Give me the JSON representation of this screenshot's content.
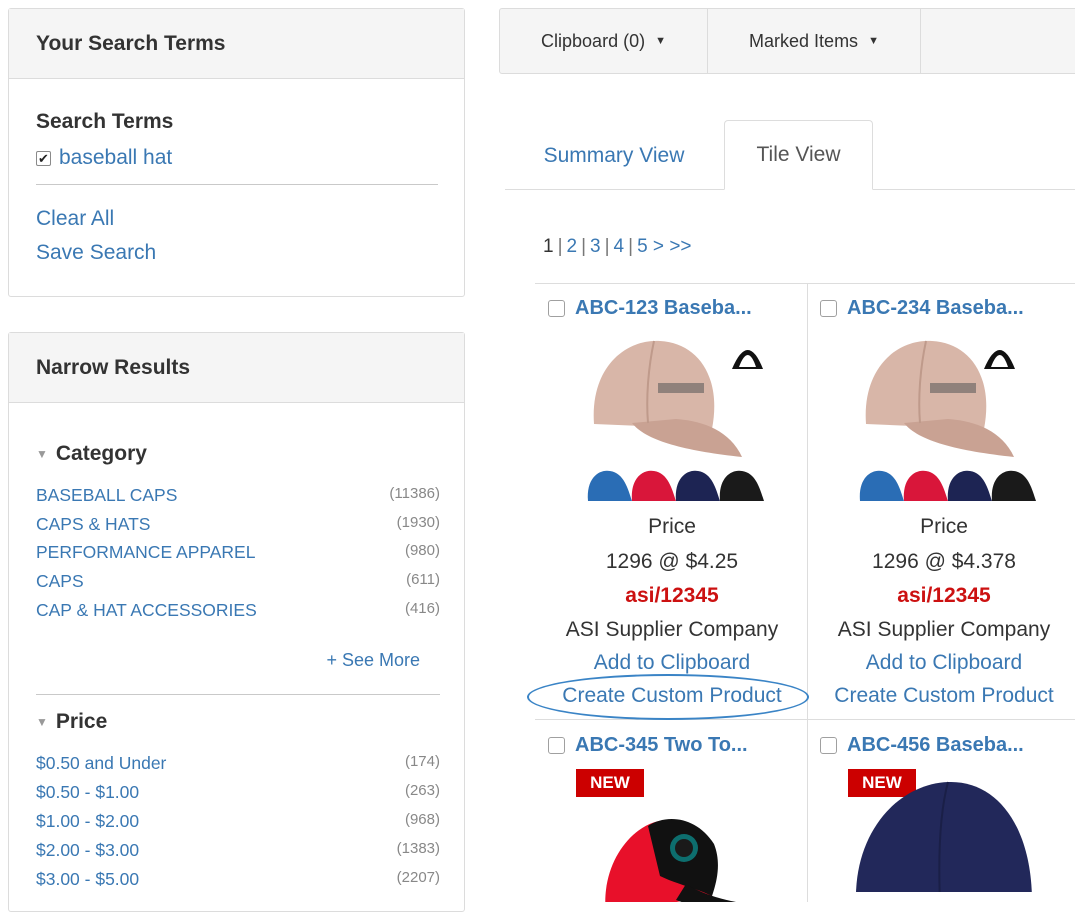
{
  "search_panel": {
    "header": "Your Search Terms",
    "section_title": "Search Terms",
    "term": "baseball hat",
    "clear_all": "Clear All",
    "save_search": "Save Search"
  },
  "narrow_panel": {
    "header": "Narrow Results",
    "category": {
      "title": "Category",
      "items": [
        {
          "label": "BASEBALL CAPS",
          "count": "(11386)"
        },
        {
          "label": "CAPS & HATS",
          "count": "(1930)"
        },
        {
          "label": "PERFORMANCE APPAREL",
          "count": "(980)"
        },
        {
          "label": "CAPS",
          "count": "(611)"
        },
        {
          "label": "CAP & HAT ACCESSORIES",
          "count": "(416)"
        }
      ],
      "see_more": "+ See More"
    },
    "price": {
      "title": "Price",
      "items": [
        {
          "label": "$0.50 and Under",
          "count": "(174)"
        },
        {
          "label": "$0.50 - $1.00",
          "count": "(263)"
        },
        {
          "label": "$1.00 - $2.00",
          "count": "(968)"
        },
        {
          "label": "$2.00 - $3.00",
          "count": "(1383)"
        },
        {
          "label": "$3.00 - $5.00",
          "count": "(2207)"
        }
      ]
    }
  },
  "toolbar": {
    "clipboard": "Clipboard (0)",
    "marked_items": "Marked Items"
  },
  "tabs": {
    "summary": "Summary View",
    "tile": "Tile View"
  },
  "pager": {
    "current": "1",
    "pages": [
      "2",
      "3",
      "4",
      "5"
    ],
    "next": ">",
    "last": ">>"
  },
  "products": [
    {
      "title": "ABC-123  Baseba...",
      "price_label": "Price",
      "price": "1296 @ $4.25",
      "code": "asi/12345",
      "supplier": "ASI Supplier Company",
      "add_link": "Add to Clipboard",
      "custom_link": "Create Custom Product"
    },
    {
      "title": "ABC-234  Baseba...",
      "price_label": "Price",
      "price": "1296 @ $4.378",
      "code": "asi/12345",
      "supplier": "ASI Supplier Company",
      "add_link": "Add to Clipboard",
      "custom_link": "Create Custom Product"
    },
    {
      "title": "ABC-345  Two To...",
      "badge": "NEW"
    },
    {
      "title": "ABC-456  Baseba...",
      "badge": "NEW"
    }
  ],
  "colors": {
    "link": "#3a78b3",
    "code_red": "#cc1111",
    "badge_red": "#cc0000",
    "cap_tan": "#d8b6a8",
    "swatches": [
      "#2a6db5",
      "#d9163a",
      "#1d2453",
      "#1a1a1a"
    ]
  }
}
